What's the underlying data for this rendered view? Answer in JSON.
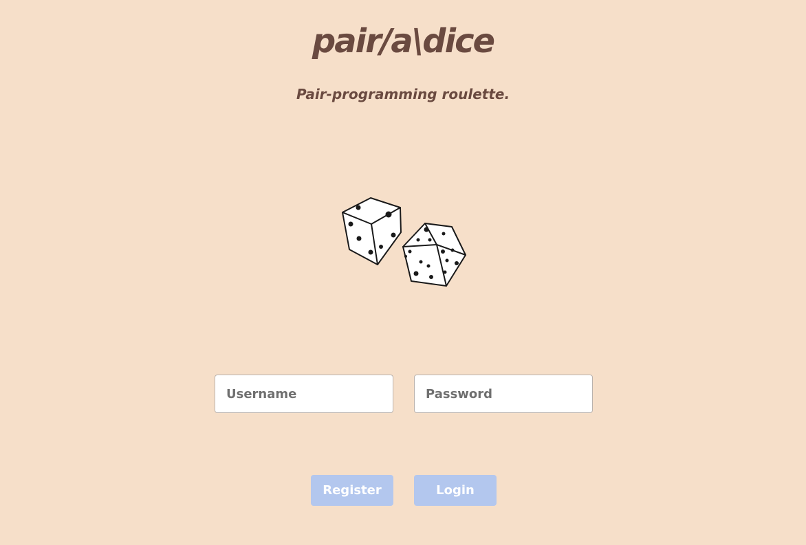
{
  "header": {
    "title": "pair/a\\dice",
    "tagline": "Pair-programming roulette."
  },
  "illustration": {
    "icon": "dice-icon"
  },
  "form": {
    "username": {
      "value": "",
      "placeholder": "Username"
    },
    "password": {
      "value": "",
      "placeholder": "Password"
    },
    "register_label": "Register",
    "login_label": "Login"
  },
  "colors": {
    "background": "#f6dfc9",
    "text": "#6a4a40",
    "button": "#b3c7ee",
    "button_text": "#ffffff",
    "input_border": "#b9b2ad"
  }
}
